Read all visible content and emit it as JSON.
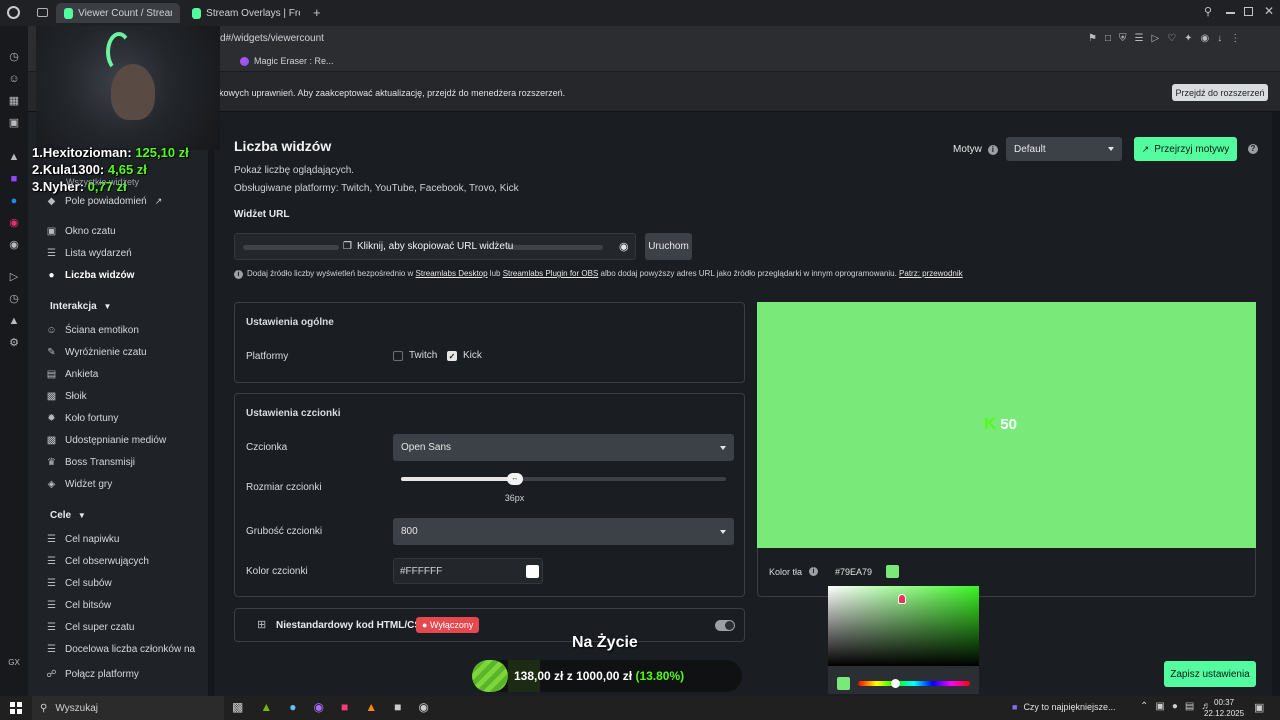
{
  "browser": {
    "tabs": [
      {
        "label": "Viewer Count / Streamlab"
      },
      {
        "label": "Stream Overlays | Free & "
      }
    ],
    "url": "d#/widgets/viewercount",
    "bookmark": "Magic Eraser : Re...",
    "infobar_text": "kowych uprawnień. Aby zaakceptować aktualizację, przejdź do menedżera rozszerzeń.",
    "infobar_button": "Przejdź do rozszerzeń"
  },
  "overlay": {
    "leaderboard": [
      {
        "rank_name": "1.Hexitozioman:",
        "amount": "125,10 zł"
      },
      {
        "rank_name": "2.Kula1300:",
        "amount": "4,65 zł"
      },
      {
        "rank_name": "3.Nyher:",
        "amount": "0,77 zł"
      }
    ],
    "hidden_nav": "Wszystkie widżety",
    "live_label": "Na Życie",
    "goal_current": "138,00 zł",
    "goal_sep": "z",
    "goal_target": "1000,00 zł",
    "goal_percent": "(13.80%)",
    "goal_progress": 0.138
  },
  "sidebar": {
    "items_top": [
      {
        "label": "Pole powiadomień",
        "icon": "bell-icon"
      },
      {
        "label": "Okno czatu",
        "icon": "chat-icon"
      },
      {
        "label": "Lista wydarzeń",
        "icon": "list-icon"
      },
      {
        "label": "Liczba widzów",
        "icon": "dot-icon"
      }
    ],
    "section_interakcja": "Interakcja",
    "items_interakcja": [
      {
        "label": "Ściana emotikon"
      },
      {
        "label": "Wyróżnienie czatu"
      },
      {
        "label": "Ankieta"
      },
      {
        "label": "Słoik"
      },
      {
        "label": "Koło fortuny"
      },
      {
        "label": "Udostępnianie mediów"
      },
      {
        "label": "Boss Transmisji"
      },
      {
        "label": "Widżet gry"
      }
    ],
    "section_cele": "Cele",
    "items_cele": [
      {
        "label": "Cel napiwku"
      },
      {
        "label": "Cel obserwujących"
      },
      {
        "label": "Cel subów"
      },
      {
        "label": "Cel bitsów"
      },
      {
        "label": "Cel super czatu"
      },
      {
        "label": "Docelowa liczba członków na"
      },
      {
        "label": "Połącz platformy"
      }
    ]
  },
  "main": {
    "title": "Liczba widzów",
    "desc1": "Pokaż liczbę oglądających.",
    "desc2": "Obsługiwane platformy: Twitch, YouTube, Facebook, Trovo, Kick",
    "theme_label": "Motyw",
    "theme_value": "Default",
    "browse_themes": "Przejrzyj motywy",
    "widget_url_label": "Widżet URL",
    "copy_url": "Kliknij, aby skopiować URL widżetu",
    "launch": "Uruchom",
    "note_pre": "Dodaj źródło liczby wyświetleń bezpośrednio w ",
    "note_link1": "Streamlabs Desktop",
    "note_mid1": " lub ",
    "note_link2": "Streamlabs Plugin for OBS",
    "note_mid2": " albo dodaj powyższy adres URL jako źródło przeglądarki w innym oprogramowaniu. ",
    "note_link3": "Patrz: przewodnik",
    "general_title": "Ustawienia ogólne",
    "platforms_label": "Platformy",
    "platform_twitch": "Twitch",
    "platform_kick": "Kick",
    "font_title": "Ustawienia czcionki",
    "font_label": "Czcionka",
    "font_value": "Open Sans",
    "size_label": "Rozmiar czcionki",
    "size_value": "36px",
    "size_fraction": 0.35,
    "weight_label": "Grubość czcionki",
    "weight_value": "800",
    "color_label": "Kolor czcionki",
    "color_value": "#FFFFFF",
    "custom_label": "Niestandardowy kod HTML/CSS",
    "custom_state": "Wyłączony",
    "preview_count": "50",
    "bg_label": "Kolor tła",
    "bg_value": "#79EA79",
    "save": "Zapisz ustawienia"
  },
  "taskbar": {
    "search": "Wyszukaj",
    "news": "Czy to najpiękniejsze...",
    "time": "00:37",
    "date": "22.12.2025"
  },
  "colors": {
    "accent": "#53fc9f",
    "preview_bg": "#79EA79",
    "kick_green": "#53fc18",
    "badge_red": "#e5484d"
  }
}
